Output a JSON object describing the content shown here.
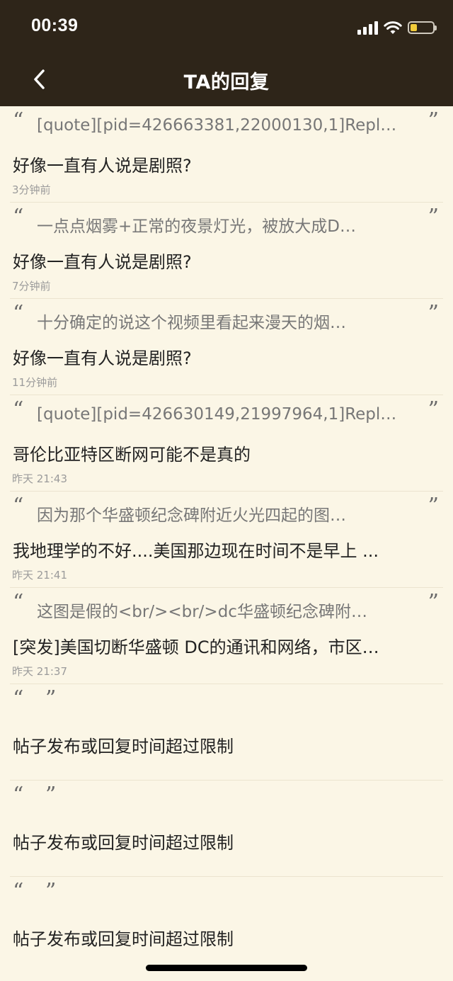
{
  "status_bar": {
    "time": "00:39"
  },
  "nav": {
    "title": "TA的回复"
  },
  "replies": [
    {
      "quote": "[quote][pid=426663381,22000130,1]Repl…",
      "title": "好像一直有人说是剧照?",
      "time": "3分钟前"
    },
    {
      "quote": "一点点烟雾+正常的夜景灯光，被放大成D…",
      "title": "好像一直有人说是剧照?",
      "time": "7分钟前"
    },
    {
      "quote": "十分确定的说这个视频里看起来漫天的烟…",
      "title": "好像一直有人说是剧照?",
      "time": "11分钟前"
    },
    {
      "quote": "[quote][pid=426630149,21997964,1]Repl…",
      "title": "哥伦比亚特区断网可能不是真的",
      "time": "昨天 21:43"
    },
    {
      "quote": "因为那个华盛顿纪念碑附近火光四起的图…",
      "title": "我地理学的不好....美国那边现在时间不是早上 ...",
      "time": "昨天 21:41"
    },
    {
      "quote": "这图是假的<br/><br/>dc华盛顿纪念碑附…",
      "title": "[突发]美国切断华盛顿 DC的通讯和网络，市区…",
      "time": "昨天 21:37"
    }
  ],
  "limited": [
    {
      "title": "帖子发布或回复时间超过限制"
    },
    {
      "title": "帖子发布或回复时间超过限制"
    },
    {
      "title": "帖子发布或回复时间超过限制"
    }
  ],
  "quote_marks": {
    "open": "“",
    "close": "”"
  },
  "colors": {
    "header_bg": "#2e2519",
    "page_bg": "#fbf6e6",
    "battery_fill": "#f2cc3a"
  },
  "icons": {
    "back": "chevron-left-icon",
    "signal": "cellular-signal-icon",
    "wifi": "wifi-icon",
    "battery": "battery-icon"
  }
}
